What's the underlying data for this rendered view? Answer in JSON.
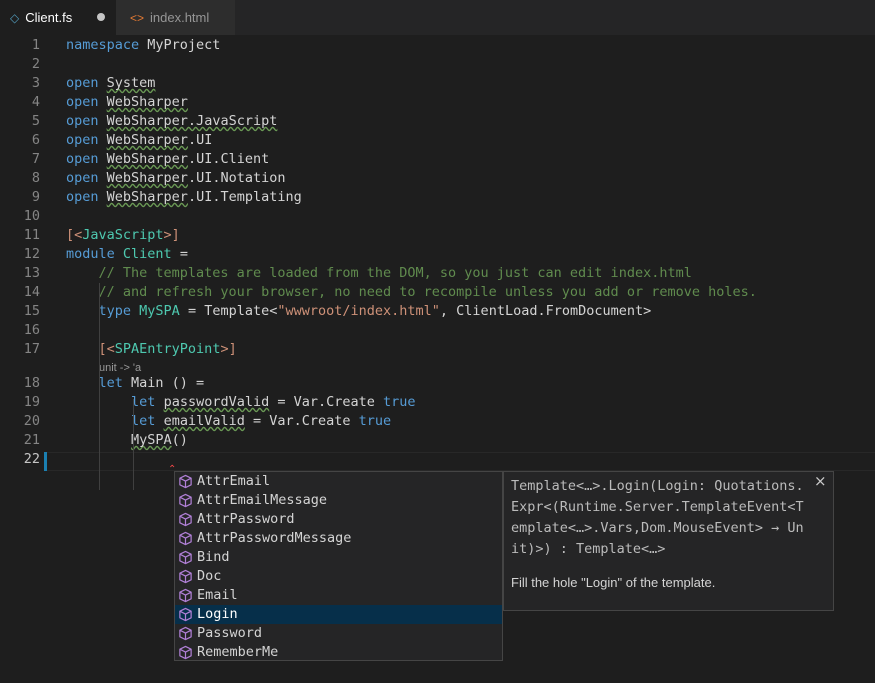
{
  "tabs": [
    {
      "label": "Client.fs",
      "icon": "fsharp-diamond-icon"
    },
    {
      "label": "index.html",
      "icon": "html-brackets-icon"
    }
  ],
  "editor": {
    "current_line": 22,
    "lens": "unit -> 'a",
    "lines": [
      {
        "n": 1,
        "tokens": [
          {
            "t": "namespace",
            "c": "kw"
          },
          {
            "t": " MyProject"
          }
        ]
      },
      {
        "n": 2,
        "tokens": []
      },
      {
        "n": 3,
        "tokens": [
          {
            "t": "open",
            "c": "kw"
          },
          {
            "t": " "
          },
          {
            "t": "System",
            "c": "sq"
          }
        ]
      },
      {
        "n": 4,
        "tokens": [
          {
            "t": "open",
            "c": "kw"
          },
          {
            "t": " "
          },
          {
            "t": "WebSharper",
            "c": "sq"
          }
        ]
      },
      {
        "n": 5,
        "tokens": [
          {
            "t": "open",
            "c": "kw"
          },
          {
            "t": " "
          },
          {
            "t": "WebSharper.JavaScript",
            "c": "sq"
          }
        ]
      },
      {
        "n": 6,
        "tokens": [
          {
            "t": "open",
            "c": "kw"
          },
          {
            "t": " "
          },
          {
            "t": "WebSharper",
            "c": "sq"
          },
          {
            "t": ".UI"
          }
        ]
      },
      {
        "n": 7,
        "tokens": [
          {
            "t": "open",
            "c": "kw"
          },
          {
            "t": " "
          },
          {
            "t": "WebSharper",
            "c": "sq"
          },
          {
            "t": ".UI.Client"
          }
        ]
      },
      {
        "n": 8,
        "tokens": [
          {
            "t": "open",
            "c": "kw"
          },
          {
            "t": " "
          },
          {
            "t": "WebSharper",
            "c": "sq"
          },
          {
            "t": ".UI.Notation"
          }
        ]
      },
      {
        "n": 9,
        "tokens": [
          {
            "t": "open",
            "c": "kw"
          },
          {
            "t": " "
          },
          {
            "t": "WebSharper",
            "c": "sq"
          },
          {
            "t": ".UI.Templating"
          }
        ]
      },
      {
        "n": 10,
        "tokens": []
      },
      {
        "n": 11,
        "tokens": [
          {
            "t": "[<",
            "c": "st"
          },
          {
            "t": "JavaScript",
            "c": "ty"
          },
          {
            "t": ">]",
            "c": "st"
          }
        ]
      },
      {
        "n": 12,
        "tokens": [
          {
            "t": "module",
            "c": "kw"
          },
          {
            "t": " "
          },
          {
            "t": "Client",
            "c": "ty"
          },
          {
            "t": " ="
          }
        ]
      },
      {
        "n": 13,
        "tokens": [
          {
            "t": "    "
          },
          {
            "t": "// The templates are loaded from the DOM, so you just can edit index.html",
            "c": "cm"
          }
        ]
      },
      {
        "n": 14,
        "tokens": [
          {
            "t": "    "
          },
          {
            "t": "// and refresh your browser, no need to recompile unless you add or remove holes.",
            "c": "cm"
          }
        ]
      },
      {
        "n": 15,
        "tokens": [
          {
            "t": "    "
          },
          {
            "t": "type",
            "c": "kw"
          },
          {
            "t": " "
          },
          {
            "t": "MySPA",
            "c": "ty"
          },
          {
            "t": " = Template<"
          },
          {
            "t": "\"wwwroot/index.html\"",
            "c": "st"
          },
          {
            "t": ", ClientLoad.FromDocument>"
          }
        ]
      },
      {
        "n": 16,
        "tokens": []
      },
      {
        "n": 17,
        "tokens": [
          {
            "t": "    "
          },
          {
            "t": "[<",
            "c": "st"
          },
          {
            "t": "SPAEntryPoint",
            "c": "ty"
          },
          {
            "t": ">]",
            "c": "st"
          }
        ]
      },
      {
        "n": 18,
        "tokens": [
          {
            "t": "    "
          },
          {
            "t": "let",
            "c": "kw"
          },
          {
            "t": " Main () ="
          }
        ]
      },
      {
        "n": 19,
        "tokens": [
          {
            "t": "        "
          },
          {
            "t": "let",
            "c": "kw"
          },
          {
            "t": " "
          },
          {
            "t": "passwordValid",
            "c": "sq"
          },
          {
            "t": " = Var.Create "
          },
          {
            "t": "true",
            "c": "kw"
          }
        ]
      },
      {
        "n": 20,
        "tokens": [
          {
            "t": "        "
          },
          {
            "t": "let",
            "c": "kw"
          },
          {
            "t": " "
          },
          {
            "t": "emailValid",
            "c": "sq"
          },
          {
            "t": " = Var.Create "
          },
          {
            "t": "true",
            "c": "kw"
          }
        ]
      },
      {
        "n": 21,
        "tokens": [
          {
            "t": "        "
          },
          {
            "t": "MySPA",
            "c": "sq"
          },
          {
            "t": "()"
          }
        ]
      },
      {
        "n": 22,
        "tokens": []
      }
    ]
  },
  "suggest": {
    "selected_index": 7,
    "items": [
      "AttrEmail",
      "AttrEmailMessage",
      "AttrPassword",
      "AttrPasswordMessage",
      "Bind",
      "Doc",
      "Email",
      "Login",
      "Password",
      "RememberMe"
    ]
  },
  "details": {
    "signature": "Template<…>.Login(Login: Quotations.Expr<(Runtime.Server.TemplateEvent<Template<…>.Vars,Dom.MouseEvent> → Unit)>) : Template<…>",
    "doc": "Fill the hole \"Login\" of the template.",
    "close": "×"
  },
  "colors": {
    "background": "#1e1e1e",
    "keyword": "#569cd6",
    "type": "#4ec9b0",
    "comment": "#608b4e",
    "string": "#ce9178",
    "selection": "#062f4a",
    "method_icon": "#b180d7"
  }
}
